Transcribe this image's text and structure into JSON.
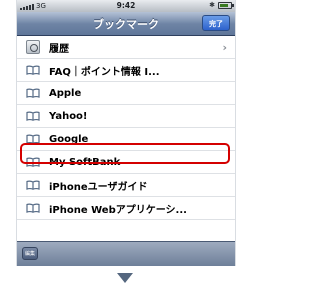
{
  "status_bar": {
    "carrier": "3G",
    "time": "9:42",
    "bluetooth": "bluetooth-icon",
    "battery_level": 0.8
  },
  "nav_bar": {
    "title": "ブックマーク",
    "done_label": "完了"
  },
  "bookmarks": [
    {
      "label": "履歴",
      "icon": "history-icon",
      "chevron": true
    },
    {
      "label": "FAQ｜ポイント情報 I...",
      "icon": "book-icon"
    },
    {
      "label": "Apple",
      "icon": "book-icon"
    },
    {
      "label": "Yahoo!",
      "icon": "book-icon"
    },
    {
      "label": "Google",
      "icon": "book-icon"
    },
    {
      "label": "My SoftBank",
      "icon": "book-icon",
      "highlighted": true
    },
    {
      "label": "iPhoneユーザガイド",
      "icon": "book-icon"
    },
    {
      "label": "iPhone Webアプリケーシ...",
      "icon": "book-icon"
    }
  ],
  "toolbar": {
    "edit_label": "編集"
  },
  "colors": {
    "highlight": "#d40000",
    "nav_bar": "#6e84a5",
    "done_button": "#2d62cc"
  }
}
